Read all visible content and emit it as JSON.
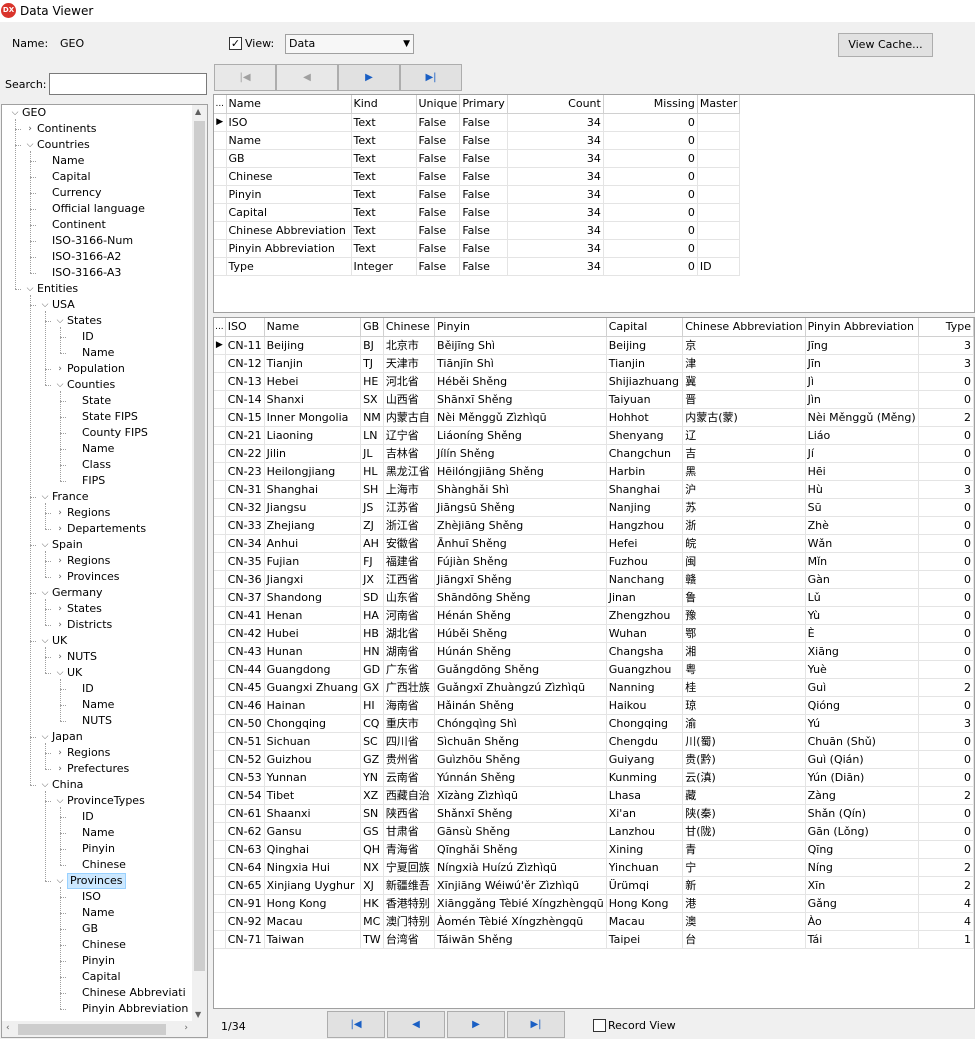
{
  "window": {
    "title": "Data Viewer",
    "app_icon": "DX"
  },
  "name_label": "Name:",
  "name_value": "GEO",
  "view_label": "View:",
  "view_checked": true,
  "view_select": "Data",
  "view_cache_button": "View Cache...",
  "search_label": "Search:",
  "search_value": "",
  "nav_top": {
    "first": "|◀",
    "prev": "◀",
    "next": "▶",
    "last": "▶|"
  },
  "tree": [
    {
      "label": "GEO",
      "level": 0,
      "toggle": "open"
    },
    {
      "label": "Continents",
      "level": 1,
      "toggle": "closed"
    },
    {
      "label": "Countries",
      "level": 1,
      "toggle": "open"
    },
    {
      "label": "Name",
      "level": 2,
      "toggle": "none"
    },
    {
      "label": "Capital",
      "level": 2,
      "toggle": "none"
    },
    {
      "label": "Currency",
      "level": 2,
      "toggle": "none"
    },
    {
      "label": "Official language",
      "level": 2,
      "toggle": "none"
    },
    {
      "label": "Continent",
      "level": 2,
      "toggle": "none"
    },
    {
      "label": "ISO-3166-Num",
      "level": 2,
      "toggle": "none"
    },
    {
      "label": "ISO-3166-A2",
      "level": 2,
      "toggle": "none"
    },
    {
      "label": "ISO-3166-A3",
      "level": 2,
      "toggle": "none"
    },
    {
      "label": "Entities",
      "level": 1,
      "toggle": "open"
    },
    {
      "label": "USA",
      "level": 2,
      "toggle": "open"
    },
    {
      "label": "States",
      "level": 3,
      "toggle": "open"
    },
    {
      "label": "ID",
      "level": 4,
      "toggle": "none"
    },
    {
      "label": "Name",
      "level": 4,
      "toggle": "none"
    },
    {
      "label": "Population",
      "level": 3,
      "toggle": "closed"
    },
    {
      "label": "Counties",
      "level": 3,
      "toggle": "open"
    },
    {
      "label": "State",
      "level": 4,
      "toggle": "none"
    },
    {
      "label": "State FIPS",
      "level": 4,
      "toggle": "none"
    },
    {
      "label": "County FIPS",
      "level": 4,
      "toggle": "none"
    },
    {
      "label": "Name",
      "level": 4,
      "toggle": "none"
    },
    {
      "label": "Class",
      "level": 4,
      "toggle": "none"
    },
    {
      "label": "FIPS",
      "level": 4,
      "toggle": "none"
    },
    {
      "label": "France",
      "level": 2,
      "toggle": "open"
    },
    {
      "label": "Regions",
      "level": 3,
      "toggle": "closed"
    },
    {
      "label": "Departements",
      "level": 3,
      "toggle": "closed"
    },
    {
      "label": "Spain",
      "level": 2,
      "toggle": "open"
    },
    {
      "label": "Regions",
      "level": 3,
      "toggle": "closed"
    },
    {
      "label": "Provinces",
      "level": 3,
      "toggle": "closed"
    },
    {
      "label": "Germany",
      "level": 2,
      "toggle": "open"
    },
    {
      "label": "States",
      "level": 3,
      "toggle": "closed"
    },
    {
      "label": "Districts",
      "level": 3,
      "toggle": "closed"
    },
    {
      "label": "UK",
      "level": 2,
      "toggle": "open"
    },
    {
      "label": "NUTS",
      "level": 3,
      "toggle": "closed"
    },
    {
      "label": "UK",
      "level": 3,
      "toggle": "open"
    },
    {
      "label": "ID",
      "level": 4,
      "toggle": "none"
    },
    {
      "label": "Name",
      "level": 4,
      "toggle": "none"
    },
    {
      "label": "NUTS",
      "level": 4,
      "toggle": "none"
    },
    {
      "label": "Japan",
      "level": 2,
      "toggle": "open"
    },
    {
      "label": "Regions",
      "level": 3,
      "toggle": "closed"
    },
    {
      "label": "Prefectures",
      "level": 3,
      "toggle": "closed"
    },
    {
      "label": "China",
      "level": 2,
      "toggle": "open"
    },
    {
      "label": "ProvinceTypes",
      "level": 3,
      "toggle": "open"
    },
    {
      "label": "ID",
      "level": 4,
      "toggle": "none"
    },
    {
      "label": "Name",
      "level": 4,
      "toggle": "none"
    },
    {
      "label": "Pinyin",
      "level": 4,
      "toggle": "none"
    },
    {
      "label": "Chinese",
      "level": 4,
      "toggle": "none"
    },
    {
      "label": "Provinces",
      "level": 3,
      "toggle": "open",
      "selected": true
    },
    {
      "label": "ISO",
      "level": 4,
      "toggle": "none"
    },
    {
      "label": "Name",
      "level": 4,
      "toggle": "none"
    },
    {
      "label": "GB",
      "level": 4,
      "toggle": "none"
    },
    {
      "label": "Chinese",
      "level": 4,
      "toggle": "none"
    },
    {
      "label": "Pinyin",
      "level": 4,
      "toggle": "none"
    },
    {
      "label": "Capital",
      "level": 4,
      "toggle": "none"
    },
    {
      "label": "Chinese Abbreviati",
      "level": 4,
      "toggle": "none"
    },
    {
      "label": "Pinyin Abbreviation",
      "level": 4,
      "toggle": "none"
    }
  ],
  "schema": {
    "corner": "...",
    "columns": [
      "Name",
      "Kind",
      "Unique",
      "Primary",
      "Count",
      "Missing",
      "Master"
    ],
    "rows": [
      [
        "ISO",
        "Text",
        "False",
        "False",
        "34",
        "0",
        ""
      ],
      [
        "Name",
        "Text",
        "False",
        "False",
        "34",
        "0",
        ""
      ],
      [
        "GB",
        "Text",
        "False",
        "False",
        "34",
        "0",
        ""
      ],
      [
        "Chinese",
        "Text",
        "False",
        "False",
        "34",
        "0",
        ""
      ],
      [
        "Pinyin",
        "Text",
        "False",
        "False",
        "34",
        "0",
        ""
      ],
      [
        "Capital",
        "Text",
        "False",
        "False",
        "34",
        "0",
        ""
      ],
      [
        "Chinese Abbreviation",
        "Text",
        "False",
        "False",
        "34",
        "0",
        ""
      ],
      [
        "Pinyin Abbreviation",
        "Text",
        "False",
        "False",
        "34",
        "0",
        ""
      ],
      [
        "Type",
        "Integer",
        "False",
        "False",
        "34",
        "0",
        "ID"
      ]
    ]
  },
  "data_grid": {
    "corner": "...",
    "columns": [
      "ISO",
      "Name",
      "GB",
      "Chinese",
      "Pinyin",
      "Capital",
      "Chinese Abbreviation",
      "Pinyin Abbreviation",
      "Type"
    ],
    "rows": [
      [
        "CN-11",
        "Beijing",
        "BJ",
        "北京市",
        "Běijīng Shì",
        "Beijing",
        "京",
        "Jīng",
        "3"
      ],
      [
        "CN-12",
        "Tianjin",
        "TJ",
        "天津市",
        "Tiānjīn Shì",
        "Tianjin",
        "津",
        "Jīn",
        "3"
      ],
      [
        "CN-13",
        "Hebei",
        "HE",
        "河北省",
        "Héběi Shěng",
        "Shijiazhuang",
        "冀",
        "Jì",
        "0"
      ],
      [
        "CN-14",
        "Shanxi",
        "SX",
        "山西省",
        "Shānxī Shěng",
        "Taiyuan",
        "晋",
        "Jìn",
        "0"
      ],
      [
        "CN-15",
        "Inner Mongolia",
        "NM",
        "内蒙古自",
        "Nèi Měnggǔ Zìzhìqū",
        "Hohhot",
        "内蒙古(蒙)",
        "Nèi Měnggǔ (Měng)",
        "2"
      ],
      [
        "CN-21",
        "Liaoning",
        "LN",
        "辽宁省",
        "Liáoníng Shěng",
        "Shenyang",
        "辽",
        "Liáo",
        "0"
      ],
      [
        "CN-22",
        "Jilin",
        "JL",
        "吉林省",
        "Jílín Shěng",
        "Changchun",
        "吉",
        "Jí",
        "0"
      ],
      [
        "CN-23",
        "Heilongjiang",
        "HL",
        "黑龙江省",
        "Hēilóngjiāng Shěng",
        "Harbin",
        "黑",
        "Hēi",
        "0"
      ],
      [
        "CN-31",
        "Shanghai",
        "SH",
        "上海市",
        "Shànghǎi Shì",
        "Shanghai",
        "沪",
        "Hù",
        "3"
      ],
      [
        "CN-32",
        "Jiangsu",
        "JS",
        "江苏省",
        "Jiāngsū Shěng",
        "Nanjing",
        "苏",
        "Sū",
        "0"
      ],
      [
        "CN-33",
        "Zhejiang",
        "ZJ",
        "浙江省",
        "Zhèjiāng Shěng",
        "Hangzhou",
        "浙",
        "Zhè",
        "0"
      ],
      [
        "CN-34",
        "Anhui",
        "AH",
        "安徽省",
        "Ānhuī Shěng",
        "Hefei",
        "皖",
        "Wǎn",
        "0"
      ],
      [
        "CN-35",
        "Fujian",
        "FJ",
        "福建省",
        "Fújiàn Shěng",
        "Fuzhou",
        "闽",
        "Mǐn",
        "0"
      ],
      [
        "CN-36",
        "Jiangxi",
        "JX",
        "江西省",
        "Jiāngxī Shěng",
        "Nanchang",
        "赣",
        "Gàn",
        "0"
      ],
      [
        "CN-37",
        "Shandong",
        "SD",
        "山东省",
        "Shāndōng Shěng",
        "Jinan",
        "鲁",
        "Lǔ",
        "0"
      ],
      [
        "CN-41",
        "Henan",
        "HA",
        "河南省",
        "Hénán Shěng",
        "Zhengzhou",
        "豫",
        "Yù",
        "0"
      ],
      [
        "CN-42",
        "Hubei",
        "HB",
        "湖北省",
        "Húběi Shěng",
        "Wuhan",
        "鄂",
        "È",
        "0"
      ],
      [
        "CN-43",
        "Hunan",
        "HN",
        "湖南省",
        "Húnán Shěng",
        "Changsha",
        "湘",
        "Xiāng",
        "0"
      ],
      [
        "CN-44",
        "Guangdong",
        "GD",
        "广东省",
        "Guǎngdōng Shěng",
        "Guangzhou",
        "粤",
        "Yuè",
        "0"
      ],
      [
        "CN-45",
        "Guangxi Zhuang",
        "GX",
        "广西壮族",
        "Guǎngxī Zhuàngzú Zìzhìqū",
        "Nanning",
        "桂",
        "Guì",
        "2"
      ],
      [
        "CN-46",
        "Hainan",
        "HI",
        "海南省",
        "Hǎinán Shěng",
        "Haikou",
        "琼",
        "Qióng",
        "0"
      ],
      [
        "CN-50",
        "Chongqing",
        "CQ",
        "重庆市",
        "Chóngqìng Shì",
        "Chongqing",
        "渝",
        "Yú",
        "3"
      ],
      [
        "CN-51",
        "Sichuan",
        "SC",
        "四川省",
        "Sìchuān Shěng",
        "Chengdu",
        "川(蜀)",
        "Chuān (Shǔ)",
        "0"
      ],
      [
        "CN-52",
        "Guizhou",
        "GZ",
        "贵州省",
        "Guìzhōu Shěng",
        "Guiyang",
        "贵(黔)",
        "Guì (Qián)",
        "0"
      ],
      [
        "CN-53",
        "Yunnan",
        "YN",
        "云南省",
        "Yúnnán Shěng",
        "Kunming",
        "云(滇)",
        "Yún (Diān)",
        "0"
      ],
      [
        "CN-54",
        "Tibet",
        "XZ",
        "西藏自治",
        "Xīzàng Zìzhìqū",
        "Lhasa",
        "藏",
        "Zàng",
        "2"
      ],
      [
        "CN-61",
        "Shaanxi",
        "SN",
        "陕西省",
        "Shǎnxī Shěng",
        "Xi'an",
        "陕(秦)",
        "Shǎn (Qín)",
        "0"
      ],
      [
        "CN-62",
        "Gansu",
        "GS",
        "甘肃省",
        "Gānsù Shěng",
        "Lanzhou",
        "甘(陇)",
        "Gān (Lǒng)",
        "0"
      ],
      [
        "CN-63",
        "Qinghai",
        "QH",
        "青海省",
        "Qīnghǎi Shěng",
        "Xining",
        "青",
        "Qīng",
        "0"
      ],
      [
        "CN-64",
        "Ningxia Hui",
        "NX",
        "宁夏回族",
        "Níngxià Huízú Zìzhìqū",
        "Yinchuan",
        "宁",
        "Níng",
        "2"
      ],
      [
        "CN-65",
        "Xinjiang Uyghur",
        "XJ",
        "新疆维吾",
        "Xīnjiāng Wéiwú'ěr Zìzhìqū",
        "Ürümqi",
        "新",
        "Xīn",
        "2"
      ],
      [
        "CN-91",
        "Hong Kong",
        "HK",
        "香港特别",
        "Xiānggǎng Tèbié Xíngzhèngqū",
        "Hong Kong",
        "港",
        "Gǎng",
        "4"
      ],
      [
        "CN-92",
        "Macau",
        "MC",
        "澳门特别",
        "Àomén Tèbié Xíngzhèngqū",
        "Macau",
        "澳",
        "Ào",
        "4"
      ],
      [
        "CN-71",
        "Taiwan",
        "TW",
        "台湾省",
        "Táiwān Shěng",
        "Taipei",
        "台",
        "Tái",
        "1"
      ]
    ]
  },
  "status": {
    "record_count": "1/34",
    "record_view_label": "Record View",
    "record_view_checked": false
  },
  "colors": {
    "accent": "#1a5fc4",
    "selection": "#cce8ff",
    "app_icon": "#d9342b"
  }
}
